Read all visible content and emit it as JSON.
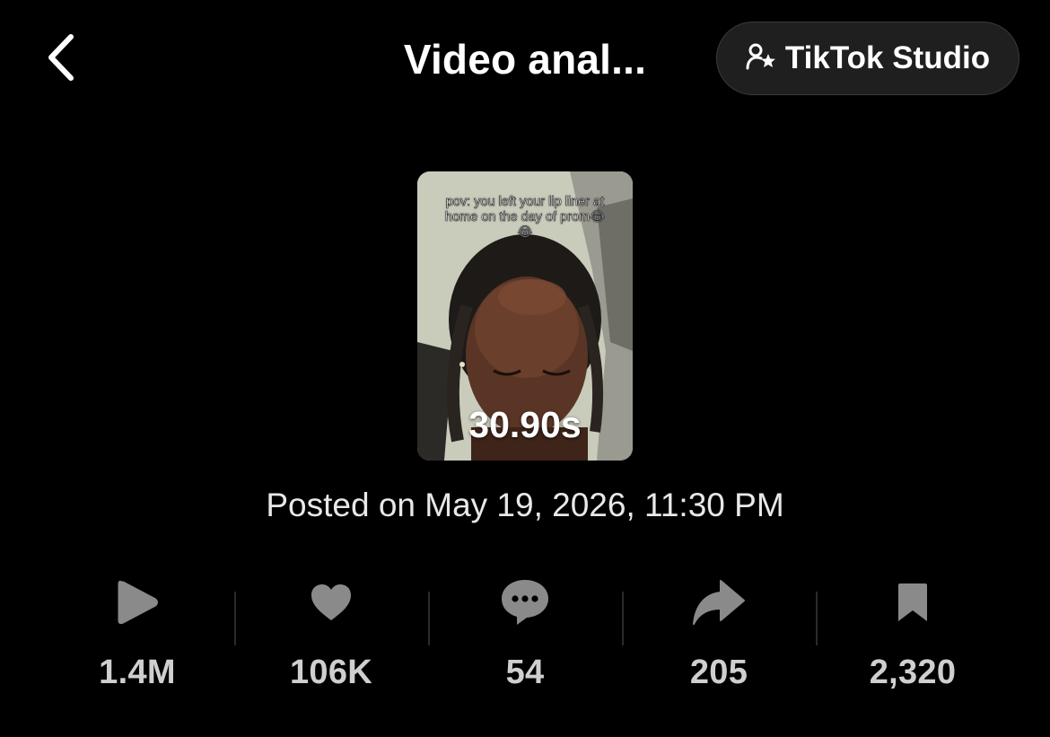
{
  "header": {
    "title": "Video anal...",
    "back_icon": "chevron-left-icon",
    "studio_button": {
      "label": "TikTok Studio",
      "icon": "user-star-icon"
    }
  },
  "video": {
    "caption": "pov: you left your lip liner at home on the day of prom😂😂",
    "duration": "30.90s",
    "posted": "Posted on May 19, 2026, 11:30 PM"
  },
  "stats": [
    {
      "icon": "play-icon",
      "value": "1.4M"
    },
    {
      "icon": "heart-icon",
      "value": "106K"
    },
    {
      "icon": "comment-icon",
      "value": "54"
    },
    {
      "icon": "share-icon",
      "value": "205"
    },
    {
      "icon": "bookmark-icon",
      "value": "2,320"
    }
  ],
  "colors": {
    "background": "#000000",
    "icon_gray": "#8a8a8a",
    "stat_text": "#cfcfcf",
    "button_bg": "#1f1f1f"
  }
}
